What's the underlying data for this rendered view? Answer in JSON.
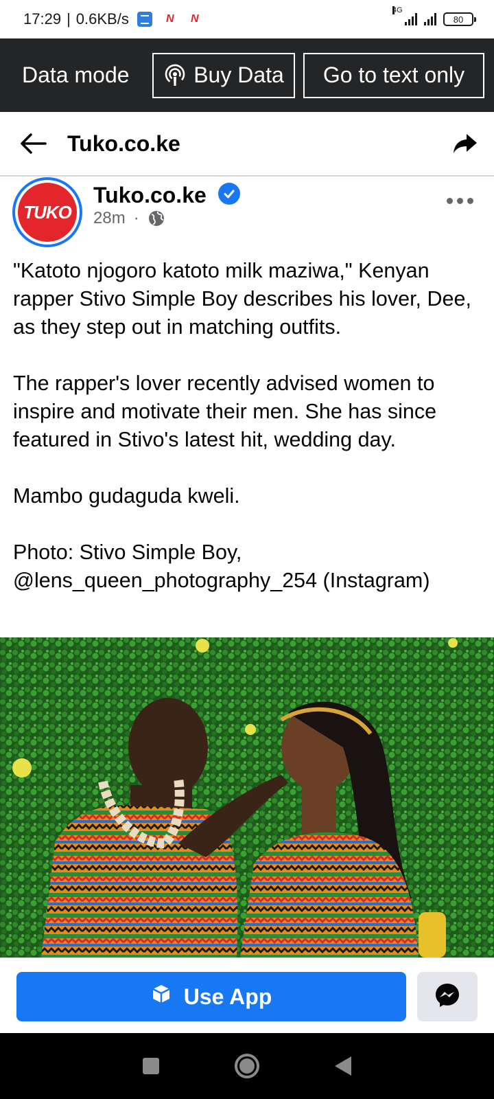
{
  "status_bar": {
    "time": "17:29",
    "speed": "0.6KB/s",
    "network_type": "4G",
    "battery": "80"
  },
  "data_bar": {
    "mode_label": "Data mode",
    "buy_data_label": "Buy Data",
    "text_only_label": "Go to text only"
  },
  "header": {
    "title": "Tuko.co.ke"
  },
  "post": {
    "author": "Tuko.co.ke",
    "avatar_text": "TUKO",
    "time": "28m",
    "dot": "·",
    "paragraphs": [
      "\"Katoto njogoro katoto milk maziwa,\" Kenyan rapper Stivo Simple Boy describes his lover, Dee, as they step out in matching outfits.",
      "The rapper's lover recently advised women to inspire and motivate their men. She has since featured in Stivo's latest hit, wedding day.",
      "Mambo gudaguda kweli.",
      "Photo: Stivo Simple Boy, @lens_queen_photography_254 (Instagram)"
    ]
  },
  "action_bar": {
    "use_app_label": "Use App"
  },
  "colors": {
    "brand_blue": "#1877f2",
    "dark_bar": "#242526",
    "tuko_red": "#e2262b"
  },
  "icons": {
    "back": "arrow-left-icon",
    "share": "share-arrow-icon",
    "verified": "verified-badge-icon",
    "globe": "globe-icon",
    "more": "more-dots-icon",
    "podcast": "podcast-icon",
    "cube": "cube-icon",
    "messenger": "messenger-icon"
  }
}
